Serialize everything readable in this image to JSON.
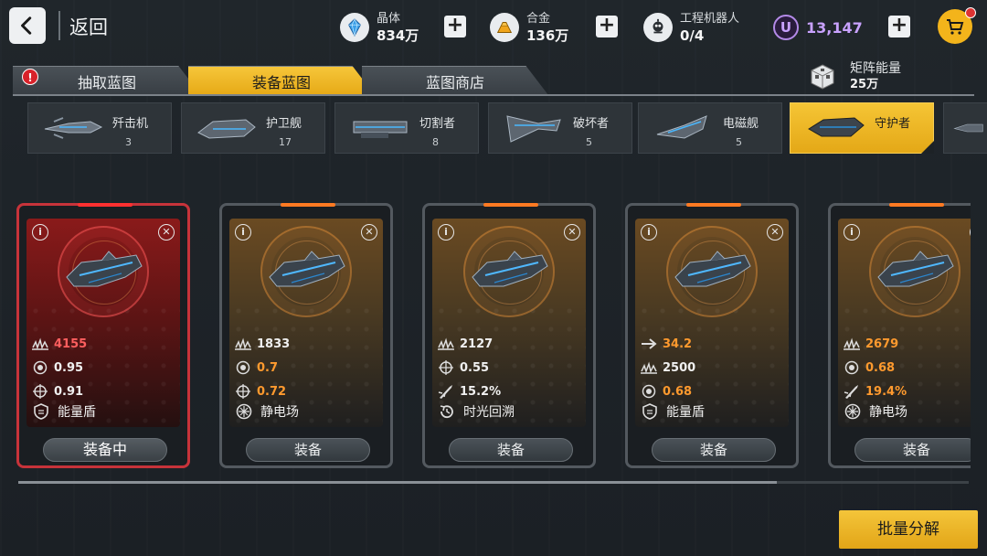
{
  "topbar": {
    "back_label": "返回",
    "crystal": {
      "name": "晶体",
      "value": "834万"
    },
    "alloy": {
      "name": "合金",
      "value": "136万"
    },
    "robot": {
      "name": "工程机器人",
      "value": "0/4"
    },
    "u_currency": {
      "symbol": "U",
      "value": "13,147"
    }
  },
  "tabs": [
    {
      "label": "抽取蓝图",
      "badge": "!"
    },
    {
      "label": "装备蓝图",
      "active": true
    },
    {
      "label": "蓝图商店"
    }
  ],
  "matrix": {
    "name": "矩阵能量",
    "value": "25万"
  },
  "ship_types": [
    {
      "label": "歼击机",
      "count": "3"
    },
    {
      "label": "护卫舰",
      "count": "17"
    },
    {
      "label": "切割者",
      "count": "8"
    },
    {
      "label": "破坏者",
      "count": "5"
    },
    {
      "label": "电磁舰",
      "count": "5"
    },
    {
      "label": "守护者",
      "count": "",
      "active": true
    }
  ],
  "cards": [
    {
      "equipped": true,
      "stats": [
        {
          "icon": "power-icon",
          "value": "4155",
          "color": "red"
        },
        {
          "icon": "gear-icon",
          "value": "0.95",
          "color": "white"
        },
        {
          "icon": "crosshair-icon",
          "value": "0.91",
          "color": "white"
        }
      ],
      "skill": {
        "icon": "shield-icon",
        "label": "能量盾"
      },
      "action": "装备中"
    },
    {
      "equipped": false,
      "stats": [
        {
          "icon": "power-icon",
          "value": "1833",
          "color": "white"
        },
        {
          "icon": "gear-icon",
          "value": "0.7",
          "color": "orange"
        },
        {
          "icon": "crosshair-icon",
          "value": "0.72",
          "color": "orange"
        }
      ],
      "skill": {
        "icon": "static-field-icon",
        "label": "静电场"
      },
      "action": "装备"
    },
    {
      "equipped": false,
      "stats": [
        {
          "icon": "power-icon",
          "value": "2127",
          "color": "white"
        },
        {
          "icon": "crosshair-icon",
          "value": "0.55",
          "color": "white"
        },
        {
          "icon": "missile-icon",
          "value": "15.2%",
          "color": "white"
        }
      ],
      "skill": {
        "icon": "time-rewind-icon",
        "label": "时光回溯"
      },
      "action": "装备"
    },
    {
      "equipped": false,
      "stats": [
        {
          "icon": "arrow-icon",
          "value": "34.2",
          "color": "orange"
        },
        {
          "icon": "power-icon",
          "value": "2500",
          "color": "white"
        },
        {
          "icon": "gear-icon",
          "value": "0.68",
          "color": "orange"
        }
      ],
      "skill": {
        "icon": "shield-icon",
        "label": "能量盾"
      },
      "action": "装备"
    },
    {
      "equipped": false,
      "stats": [
        {
          "icon": "power-icon",
          "value": "2679",
          "color": "orange"
        },
        {
          "icon": "gear-icon",
          "value": "0.68",
          "color": "orange"
        },
        {
          "icon": "missile-icon",
          "value": "19.4%",
          "color": "orange"
        }
      ],
      "skill": {
        "icon": "static-field-icon",
        "label": "静电场"
      },
      "action": "装备"
    }
  ],
  "bulk_button": "批量分解",
  "colors": {
    "accent": "#f3b41b",
    "equipped": "#c7333a",
    "highlight": "#ff9a2e",
    "u_currency": "#c9a2ff"
  }
}
